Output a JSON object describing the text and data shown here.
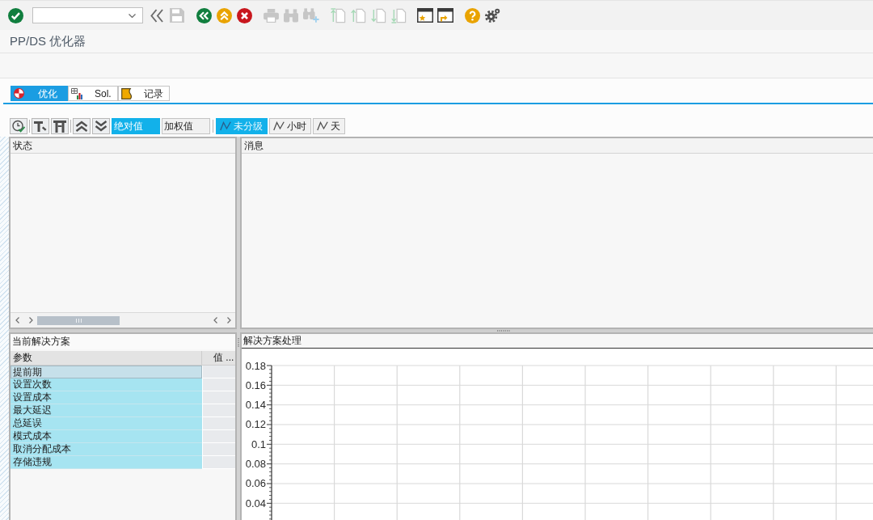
{
  "toolbar": {
    "groups": [
      [
        {
          "kind": "enter",
          "disabled": false
        },
        {
          "kind": "command_field",
          "disabled": false
        },
        {
          "kind": "toggle_command_field",
          "disabled": false
        },
        {
          "kind": "save",
          "disabled": true
        }
      ],
      [
        {
          "kind": "back",
          "disabled": false
        },
        {
          "kind": "exit",
          "disabled": false
        },
        {
          "kind": "cancel",
          "disabled": false
        }
      ],
      [
        {
          "kind": "print",
          "disabled": true
        },
        {
          "kind": "find",
          "disabled": true
        },
        {
          "kind": "find_next",
          "disabled": true
        }
      ],
      [
        {
          "kind": "first_page",
          "disabled": true
        },
        {
          "kind": "previous_page",
          "disabled": true
        },
        {
          "kind": "next_page",
          "disabled": true
        },
        {
          "kind": "last_page",
          "disabled": true
        }
      ],
      [
        {
          "kind": "new_session",
          "disabled": false
        },
        {
          "kind": "shortcut",
          "disabled": false
        }
      ],
      [
        {
          "kind": "help",
          "disabled": false
        },
        {
          "kind": "settings",
          "disabled": false
        }
      ]
    ]
  },
  "title": "PP/DS 优化器",
  "tabs": [
    {
      "label": "优化",
      "selected": true
    },
    {
      "label": "Sol.",
      "selected": false
    },
    {
      "label": "记录",
      "selected": false
    }
  ],
  "app_toolbar": {
    "icon_groups": [
      [
        {
          "kind": "refresh"
        }
      ],
      [
        {
          "kind": "tool"
        },
        {
          "kind": "table_tool"
        }
      ],
      [
        {
          "kind": "collapse"
        },
        {
          "kind": "expand"
        }
      ]
    ],
    "value_modes": [
      {
        "label": "绝对值",
        "selected": true
      },
      {
        "label": "加权值",
        "selected": false
      }
    ],
    "time_scales": [
      {
        "label": "未分级",
        "selected": true
      },
      {
        "label": "小时",
        "selected": false
      },
      {
        "label": "天",
        "selected": false
      }
    ]
  },
  "status_panel": {
    "header": "状态"
  },
  "message_panel": {
    "header": "消息"
  },
  "current_solution": {
    "title": "当前解决方案",
    "columns": [
      "参数",
      "值 ..."
    ],
    "rows": [
      {
        "parameter": "提前期",
        "focused": true
      },
      {
        "parameter": "设置次数",
        "focused": false
      },
      {
        "parameter": "设置成本",
        "focused": false
      },
      {
        "parameter": "最大延迟",
        "focused": false
      },
      {
        "parameter": "总延误",
        "focused": false
      },
      {
        "parameter": "模式成本",
        "focused": false
      },
      {
        "parameter": "取消分配成本",
        "focused": false
      },
      {
        "parameter": "存储违规",
        "focused": false
      }
    ]
  },
  "solution_processing": {
    "title": "解决方案处理",
    "chart_data": {
      "type": "line",
      "categories": [
        null,
        null,
        null,
        null,
        null,
        null,
        null,
        null,
        null
      ],
      "values": [
        null,
        null,
        null,
        null,
        null,
        null,
        null,
        null,
        null
      ],
      "ylim": [
        0.023,
        0.18
      ],
      "yticks": [
        0.04,
        0.06,
        0.08,
        0.1,
        0.12,
        0.14,
        0.16,
        0.18
      ],
      "tick_labels": "y",
      "grid": true
    }
  }
}
